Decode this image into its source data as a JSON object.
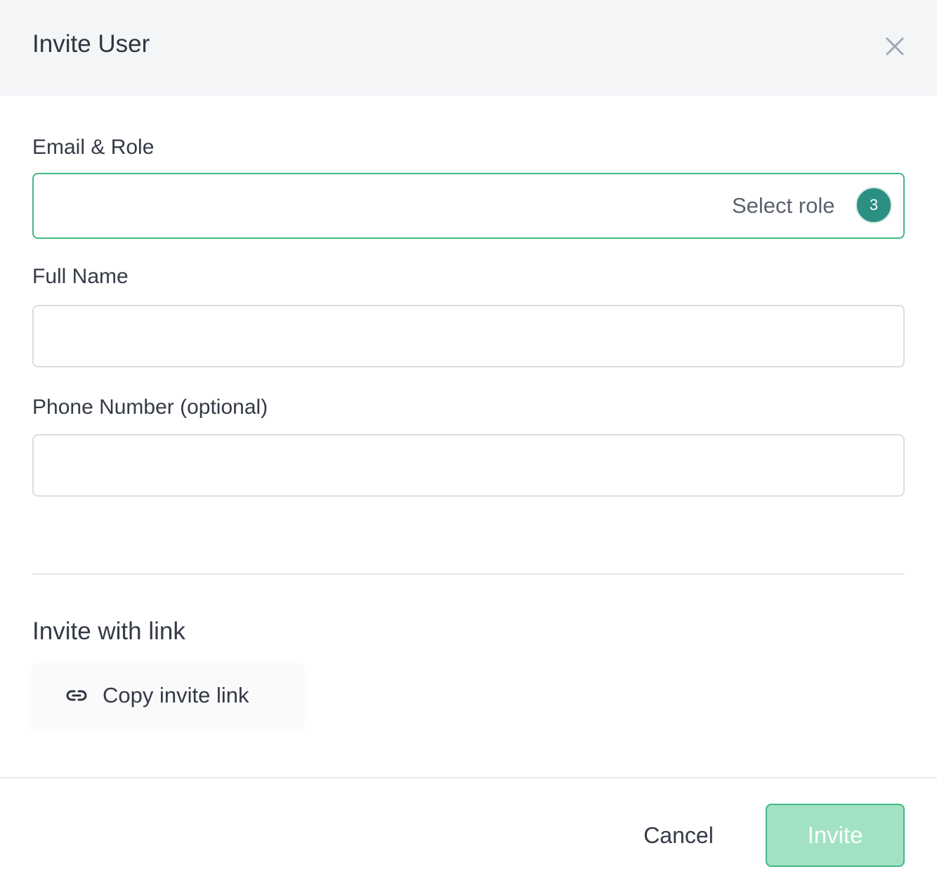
{
  "dialog": {
    "title": "Invite User",
    "close_icon": "close-icon"
  },
  "form": {
    "email_role": {
      "label": "Email & Role",
      "email_value": "",
      "role_placeholder": "Select role",
      "badge_count": "3"
    },
    "full_name": {
      "label": "Full Name",
      "value": ""
    },
    "phone": {
      "label": "Phone Number (optional)",
      "value": ""
    }
  },
  "invite_link": {
    "title": "Invite with link",
    "button_label": "Copy invite link",
    "icon": "link-icon"
  },
  "footer": {
    "cancel_label": "Cancel",
    "invite_label": "Invite"
  },
  "colors": {
    "accent": "#41b883",
    "badge": "#2b8f82",
    "invite_disabled_bg": "#a2e2c2"
  }
}
